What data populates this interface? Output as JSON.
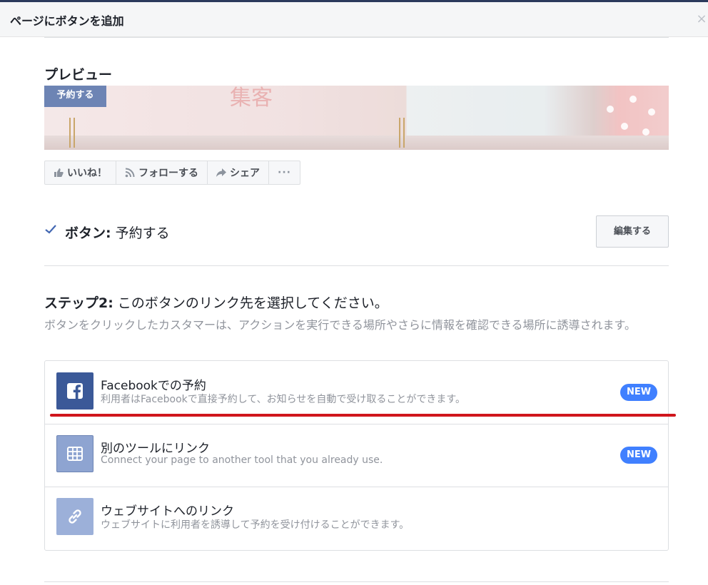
{
  "dialog": {
    "title": "ページにボタンを追加",
    "close_icon": "×"
  },
  "preview": {
    "label": "プレビュー",
    "cover_button": "予約する",
    "cover_text": "集客"
  },
  "page_actions": [
    {
      "icon": "thumbs-up-icon",
      "label": "いいね！"
    },
    {
      "icon": "rss-icon",
      "label": "フォローする"
    },
    {
      "icon": "share-arrow-icon",
      "label": "シェア"
    },
    {
      "icon": "more-icon",
      "label": "···"
    }
  ],
  "button_row": {
    "label": "ボタン:",
    "value": "予約する",
    "edit_label": "編集する"
  },
  "step2": {
    "title": "ステップ2:",
    "text": "このボタンのリンク先を選択してください。",
    "description": "ボタンをクリックしたカスタマーは、アクションを実行できる場所やさらに情報を確認できる場所に誘導されます。"
  },
  "options": [
    {
      "title": "Facebookでの予約",
      "subtitle": "利用者はFacebookで直接予約して、お知らせを自動で受け取ることができます。",
      "badge": "NEW",
      "icon": "facebook-icon",
      "icon_bg": "#3b5998"
    },
    {
      "title": "別のツールにリンク",
      "subtitle": "Connect your page to another tool that you already use.",
      "badge": "NEW",
      "icon": "table-icon",
      "icon_bg": "#8ea4d1"
    },
    {
      "title": "ウェブサイトへのリンク",
      "subtitle": "ウェブサイトに利用者を誘導して予約を受け付けることができます。",
      "icon": "link-icon",
      "icon_bg": "#9cb0d9"
    }
  ],
  "colors": {
    "accent": "#4080ff",
    "annotation": "#d0161c"
  }
}
